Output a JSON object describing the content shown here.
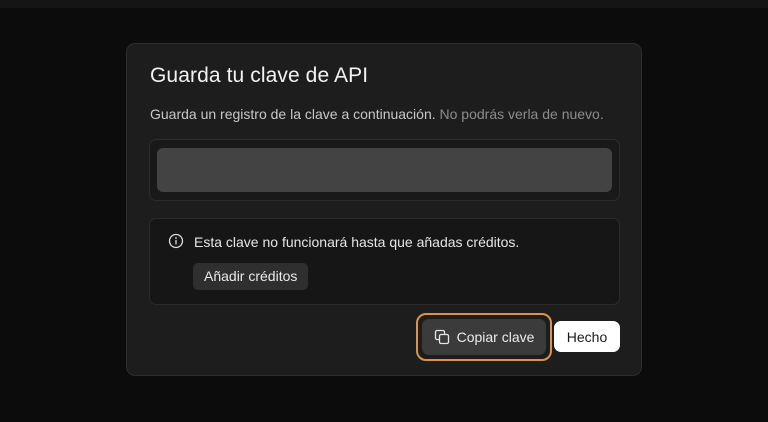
{
  "modal": {
    "title": "Guarda tu clave de API",
    "subtitle_main": "Guarda un registro de la clave a continuación.",
    "subtitle_warning": "No podrás verla de nuevo.",
    "key_field": {
      "value": ""
    },
    "notice": {
      "icon": "info-icon",
      "text": "Esta clave no funcionará hasta que añadas créditos.",
      "add_credits_label": "Añadir créditos"
    },
    "actions": {
      "copy_icon": "copy-icon",
      "copy_label": "Copiar clave",
      "done_label": "Hecho"
    }
  },
  "colors": {
    "focus_ring": "#d8944f",
    "primary_button": "#ffffff",
    "modal_background": "#1d1d1d"
  }
}
